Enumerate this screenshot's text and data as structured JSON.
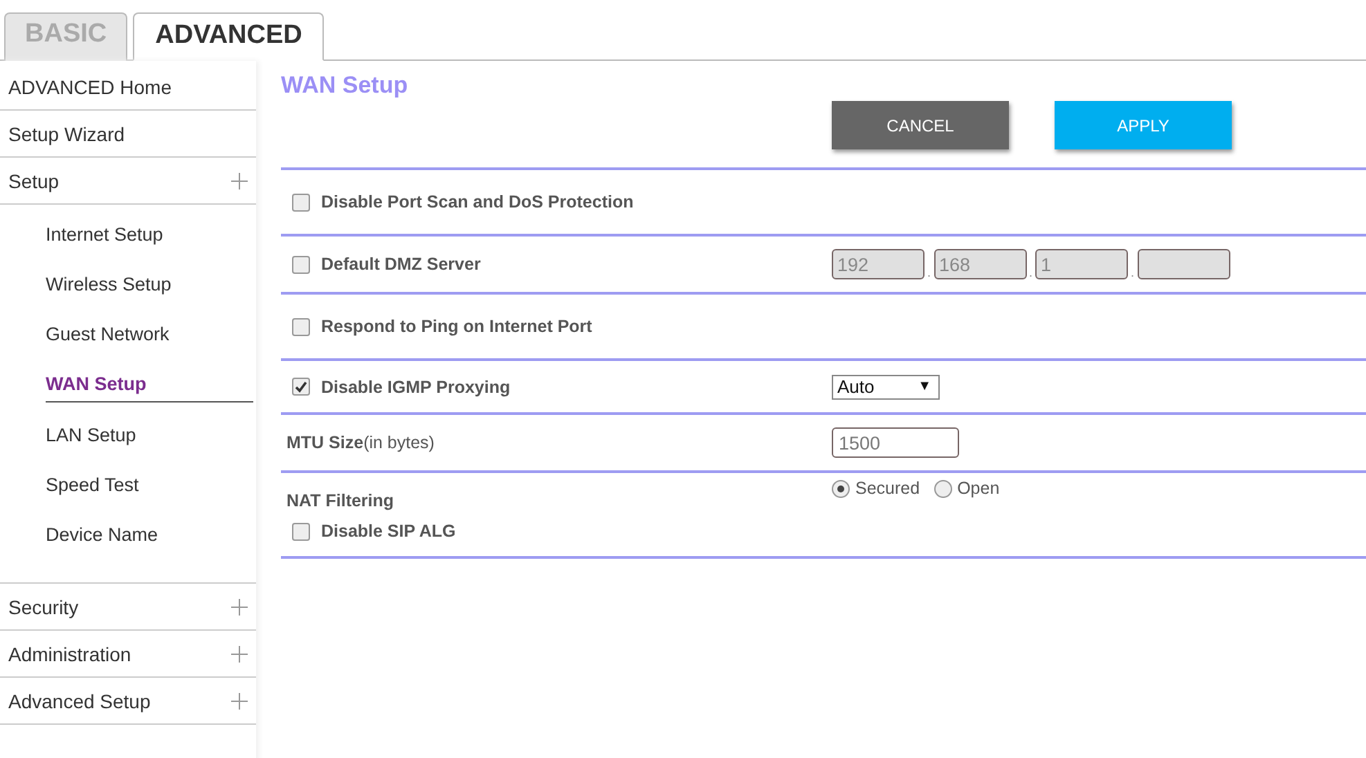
{
  "tabs": [
    {
      "label": "BASIC",
      "selected": false
    },
    {
      "label": "ADVANCED",
      "selected": true
    }
  ],
  "sidebar": {
    "items": [
      {
        "label": "ADVANCED Home",
        "expandable": false
      },
      {
        "label": "Setup Wizard",
        "expandable": false
      },
      {
        "label": "Setup",
        "expandable": true,
        "children": [
          {
            "label": "Internet Setup",
            "selected": false
          },
          {
            "label": "Wireless Setup",
            "selected": false
          },
          {
            "label": "Guest Network",
            "selected": false
          },
          {
            "label": "WAN Setup",
            "selected": true
          },
          {
            "label": "LAN Setup",
            "selected": false
          },
          {
            "label": "Speed Test",
            "selected": false
          },
          {
            "label": "Device Name",
            "selected": false
          }
        ]
      },
      {
        "label": "Security",
        "expandable": true
      },
      {
        "label": "Administration",
        "expandable": true
      },
      {
        "label": "Advanced Setup",
        "expandable": true
      }
    ]
  },
  "page_title": "WAN Setup",
  "buttons": [
    {
      "label": "CANCEL",
      "kind": "cancel"
    },
    {
      "label": "APPLY",
      "kind": "apply"
    }
  ],
  "rows": [
    {
      "kind": "checkbox",
      "label": "Disable Port Scan and DoS Protection",
      "checked": false
    },
    {
      "kind": "ip",
      "label": "Default DMZ Server",
      "checked": false,
      "separator": ".",
      "octets": [
        {
          "kind": "filled",
          "value": "192"
        },
        {
          "kind": "filled",
          "value": "168"
        },
        {
          "kind": "filled",
          "value": "1"
        },
        {
          "kind": "empty"
        }
      ]
    },
    {
      "kind": "checkbox",
      "label": "Respond to Ping on Internet Port",
      "checked": false
    },
    {
      "kind": "select",
      "label": "Disable IGMP Proxying",
      "checked": true,
      "value": "Auto",
      "arrow": "▼"
    },
    {
      "kind": "input",
      "label": "MTU Size",
      "note": "(in bytes)",
      "value": "1500"
    },
    {
      "kind": "nat",
      "label": "NAT Filtering",
      "options": [
        {
          "label": "Secured",
          "selected": true
        },
        {
          "label": "Open",
          "selected": false
        }
      ],
      "sub": {
        "label": "Disable SIP ALG",
        "checked": false
      }
    }
  ]
}
